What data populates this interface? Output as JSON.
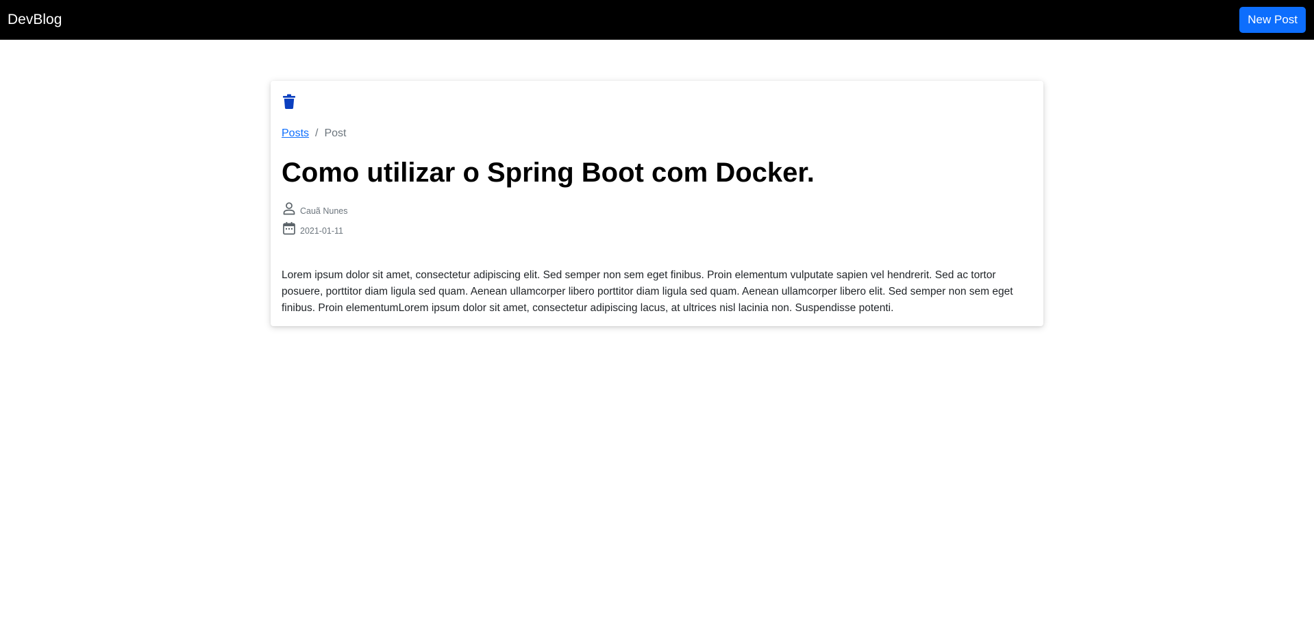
{
  "navbar": {
    "brand": "DevBlog",
    "new_post_label": "New Post"
  },
  "post": {
    "breadcrumb": {
      "posts_link": "Posts",
      "separator": "/",
      "current": "Post"
    },
    "title": "Como utilizar o Spring Boot com Docker.",
    "author": "Cauã Nunes",
    "date": "2021-01-11",
    "body": "Lorem ipsum dolor sit amet, consectetur adipiscing elit. Sed semper non sem eget finibus. Proin elementum vulputate sapien vel hendrerit. Sed ac tortor posuere, porttitor diam ligula sed quam. Aenean ullamcorper libero porttitor diam ligula sed quam. Aenean ullamcorper libero elit. Sed semper non sem eget finibus. Proin elementumLorem ipsum dolor sit amet, consectetur adipiscing lacus, at ultrices nisl lacinia non. Suspendisse potenti."
  },
  "icons": {
    "delete": "trash-icon",
    "author": "person-icon",
    "date": "calendar-icon"
  },
  "colors": {
    "navbar_bg": "#000000",
    "primary": "#0d6efd",
    "trash_icon": "#0b3fbf",
    "muted": "#6c757d",
    "text": "#212529"
  }
}
